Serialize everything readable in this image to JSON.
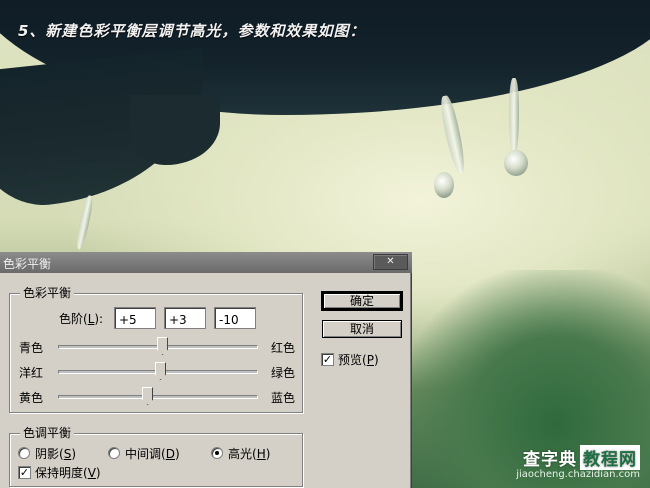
{
  "headline": "5、新建色彩平衡层调节高光，参数和效果如图：",
  "watermark": {
    "site_part1": "查字典",
    "site_part2": "教程网",
    "url": "jiaocheng.chazidian.com"
  },
  "dialog": {
    "title": "色彩平衡",
    "close_glyph": "✕",
    "color_balance_group": {
      "title": "色彩平衡",
      "levels_label_prefix": "色阶(",
      "levels_label_key": "L",
      "levels_label_suffix": "):",
      "levels": [
        "+5",
        "+3",
        "-10"
      ],
      "sliders": [
        {
          "left": "青色",
          "right": "红色",
          "value": 5
        },
        {
          "left": "洋红",
          "right": "绿色",
          "value": 3
        },
        {
          "left": "黄色",
          "right": "蓝色",
          "value": -10
        }
      ]
    },
    "tone_balance_group": {
      "title": "色调平衡",
      "options": [
        {
          "label": "阴影(",
          "key": "S",
          "suffix": ")",
          "selected": false
        },
        {
          "label": "中间调(",
          "key": "D",
          "suffix": ")",
          "selected": false
        },
        {
          "label": "高光(",
          "key": "H",
          "suffix": ")",
          "selected": true
        }
      ],
      "preserve_luminosity": {
        "label": "保持明度(",
        "key": "V",
        "suffix": ")",
        "checked": true
      }
    },
    "buttons": {
      "ok": "确定",
      "cancel": "取消"
    },
    "preview": {
      "label": "预览(",
      "key": "P",
      "suffix": ")",
      "checked": true
    },
    "check_glyph": "✓"
  }
}
